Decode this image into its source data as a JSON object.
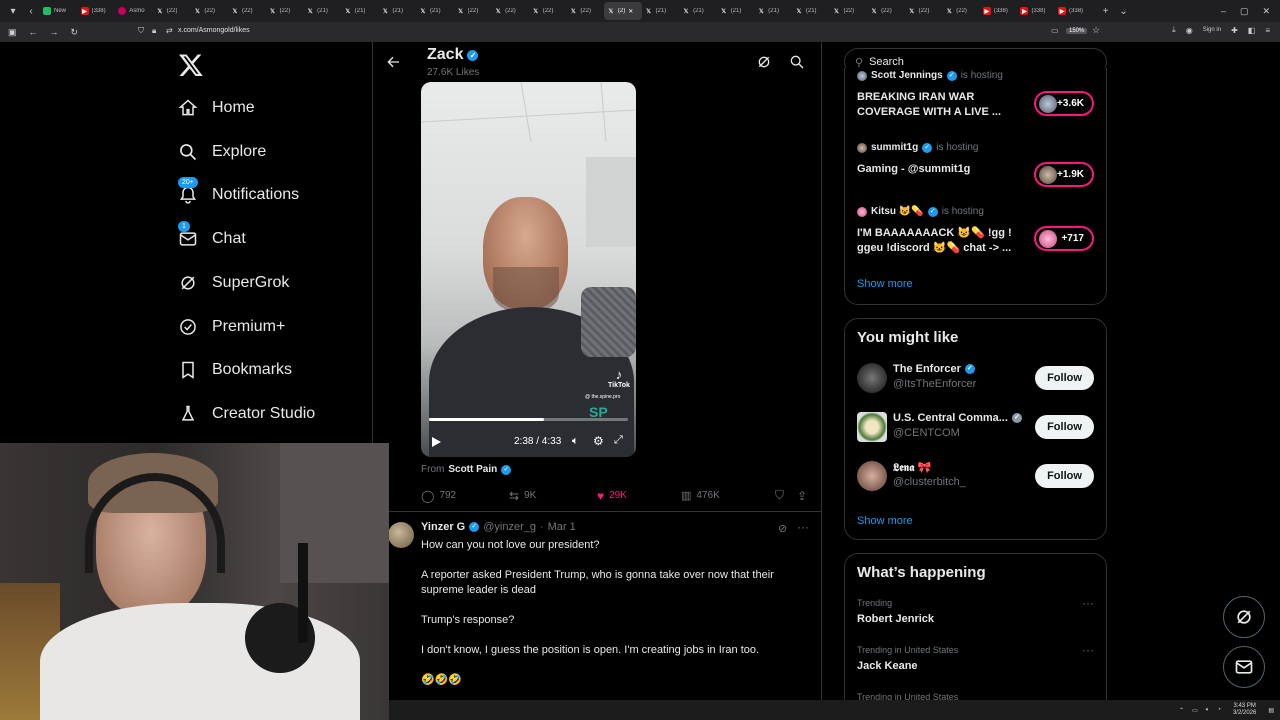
{
  "browser": {
    "tabs": [
      {
        "label": "New",
        "fav": "wb"
      },
      {
        "label": "(338)",
        "fav": "yt"
      },
      {
        "label": "Asmo",
        "fav": "tw"
      },
      {
        "label": "(22)",
        "fav": "x"
      },
      {
        "label": "(22)",
        "fav": "x"
      },
      {
        "label": "(22)",
        "fav": "x"
      },
      {
        "label": "(22)",
        "fav": "x"
      },
      {
        "label": "(21)",
        "fav": "x"
      },
      {
        "label": "(21)",
        "fav": "x"
      },
      {
        "label": "(21)",
        "fav": "x"
      },
      {
        "label": "(21)",
        "fav": "x"
      },
      {
        "label": "(22)",
        "fav": "x"
      },
      {
        "label": "(22)",
        "fav": "x"
      },
      {
        "label": "(22)",
        "fav": "x"
      },
      {
        "label": "(22)",
        "fav": "x"
      },
      {
        "label": "(2)",
        "fav": "x",
        "active": true
      },
      {
        "label": "(21)",
        "fav": "x"
      },
      {
        "label": "(21)",
        "fav": "x"
      },
      {
        "label": "(21)",
        "fav": "x"
      },
      {
        "label": "(21)",
        "fav": "x"
      },
      {
        "label": "(21)",
        "fav": "x"
      },
      {
        "label": "(22)",
        "fav": "x"
      },
      {
        "label": "(22)",
        "fav": "x"
      },
      {
        "label": "(22)",
        "fav": "x"
      },
      {
        "label": "(22)",
        "fav": "x"
      },
      {
        "label": "(338)",
        "fav": "yt"
      },
      {
        "label": "(338)",
        "fav": "yt"
      },
      {
        "label": "(338)",
        "fav": "yt"
      }
    ],
    "url": "x.com/Asmongold/likes",
    "zoom": "150%",
    "signin": "Sign in"
  },
  "nav": {
    "logo": "X",
    "items": [
      {
        "label": "Home",
        "icon": "home-icon"
      },
      {
        "label": "Explore",
        "icon": "search-icon"
      },
      {
        "label": "Notifications",
        "icon": "bell-icon",
        "badge": "20+"
      },
      {
        "label": "Chat",
        "icon": "mail-icon",
        "badge": "1"
      },
      {
        "label": "SuperGrok",
        "icon": "grok-icon"
      },
      {
        "label": "Premium+",
        "icon": "verified-icon"
      },
      {
        "label": "Bookmarks",
        "icon": "bookmark-icon"
      },
      {
        "label": "Creator Studio",
        "icon": "flask-icon"
      }
    ]
  },
  "profile": {
    "name": "Zack",
    "likes": "27.6K Likes"
  },
  "video": {
    "time": "2:38 / 4:33",
    "watermark": "TikTok",
    "handle": "@ the.spine.pro",
    "progress": 0.58
  },
  "tweet1": {
    "from_label": "From",
    "from_name": "Scott Pain",
    "replies": "792",
    "reposts": "9K",
    "likes": "29K",
    "views": "476K"
  },
  "tweet2": {
    "name": "Yinzer G",
    "handle": "@yinzer_g",
    "date": "Mar 1",
    "lines": [
      "How can you not love our president?",
      "A reporter asked President Trump, who is gonna take over now that their supreme leader is dead",
      "Trump's response?",
      "I don't know, I guess the position is open. I'm creating jobs in Iran too.",
      "🤣🤣🤣"
    ]
  },
  "search": {
    "placeholder": "Search"
  },
  "live": {
    "items": [
      {
        "host": "Scott Jennings",
        "hosting": "is hosting",
        "title": "BREAKING IRAN WAR COVERAGE WITH A LIVE ...",
        "count": "+3.6K"
      },
      {
        "host": "summit1g",
        "hosting": "is hosting",
        "title": "Gaming - @summit1g",
        "count": "+1.9K"
      },
      {
        "host": "Kitsu 😺💊",
        "hosting": "is hosting",
        "title": "I'M BAAAAAAACK 😺💊 !gg ! ggeu !discord 😺💊 chat -> ...",
        "count": "+717"
      }
    ],
    "show_more": "Show more"
  },
  "suggest": {
    "title": "You might like",
    "items": [
      {
        "name": "The Enforcer",
        "handle": "@ItsTheEnforcer",
        "button": "Follow"
      },
      {
        "name": "U.S. Central Comma...",
        "handle": "@CENTCOM",
        "button": "Follow"
      },
      {
        "name": "𝕷𝖊𝖓𝖆 🎀",
        "handle": "@clusterbitch_",
        "button": "Follow"
      }
    ],
    "show_more": "Show more"
  },
  "trends": {
    "title": "What’s happening",
    "items": [
      {
        "context": "Trending",
        "name": "Robert Jenrick"
      },
      {
        "context": "Trending in United States",
        "name": "Jack Keane"
      },
      {
        "context": "Trending in United States",
        "name": ""
      }
    ]
  },
  "taskbar": {
    "time": "3:43 PM",
    "date": "3/2/2026"
  },
  "colors": {
    "accent": "#1d9bf0",
    "like": "#f91880",
    "border": "#2f3336",
    "muted": "#71767b"
  }
}
